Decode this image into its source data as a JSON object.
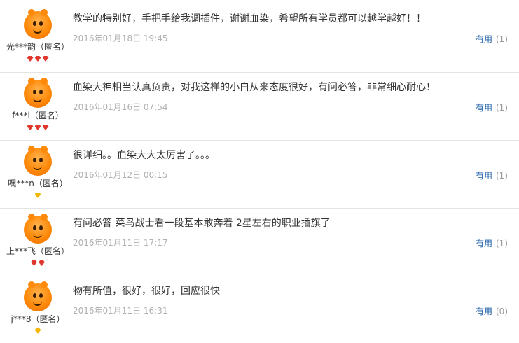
{
  "reviews": [
    {
      "user": "光***韵（匿名）",
      "level_gems": [
        "red",
        "red",
        "red"
      ],
      "content": "教学的特别好，手把手给我调插件，谢谢血染，希望所有学员都可以越学越好！！",
      "date": "2016年01月18日 19:45",
      "useful_label": "有用",
      "useful_count": "(1)"
    },
    {
      "user": "f***l（匿名）",
      "level_gems": [
        "red",
        "red",
        "red"
      ],
      "content": "血染大神相当认真负责，对我这样的小白从来态度很好，有问必答，非常细心耐心！",
      "date": "2016年01月16日 07:54",
      "useful_label": "有用",
      "useful_count": "(1)"
    },
    {
      "user": "嘿***n（匿名）",
      "level_gems": [
        "gold"
      ],
      "content": "很详细。。血染大大太厉害了。。。",
      "date": "2016年01月12日 00:15",
      "useful_label": "有用",
      "useful_count": "(1)"
    },
    {
      "user": "上***飞（匿名）",
      "level_gems": [
        "red",
        "red"
      ],
      "content": "有问必答 菜鸟战士看一段基本敢奔着 2星左右的职业插旗了",
      "date": "2016年01月11日 17:17",
      "useful_label": "有用",
      "useful_count": "(1)"
    },
    {
      "user": "j***8（匿名）",
      "level_gems": [
        "gold"
      ],
      "content": "物有所值，很好，很好，回应很快",
      "date": "2016年01月11日 16:31",
      "useful_label": "有用",
      "useful_count": "(0)"
    }
  ],
  "colors": {
    "link": "#1f5fa8",
    "muted": "#b0b0b0",
    "gem_red": "#e0382e",
    "gem_gold": "#f2b705",
    "avatar": "#ff8a0a"
  },
  "icons": {
    "avatar": "orange-mascot-avatar-icon",
    "level_gem": "diamond-gem-icon"
  }
}
